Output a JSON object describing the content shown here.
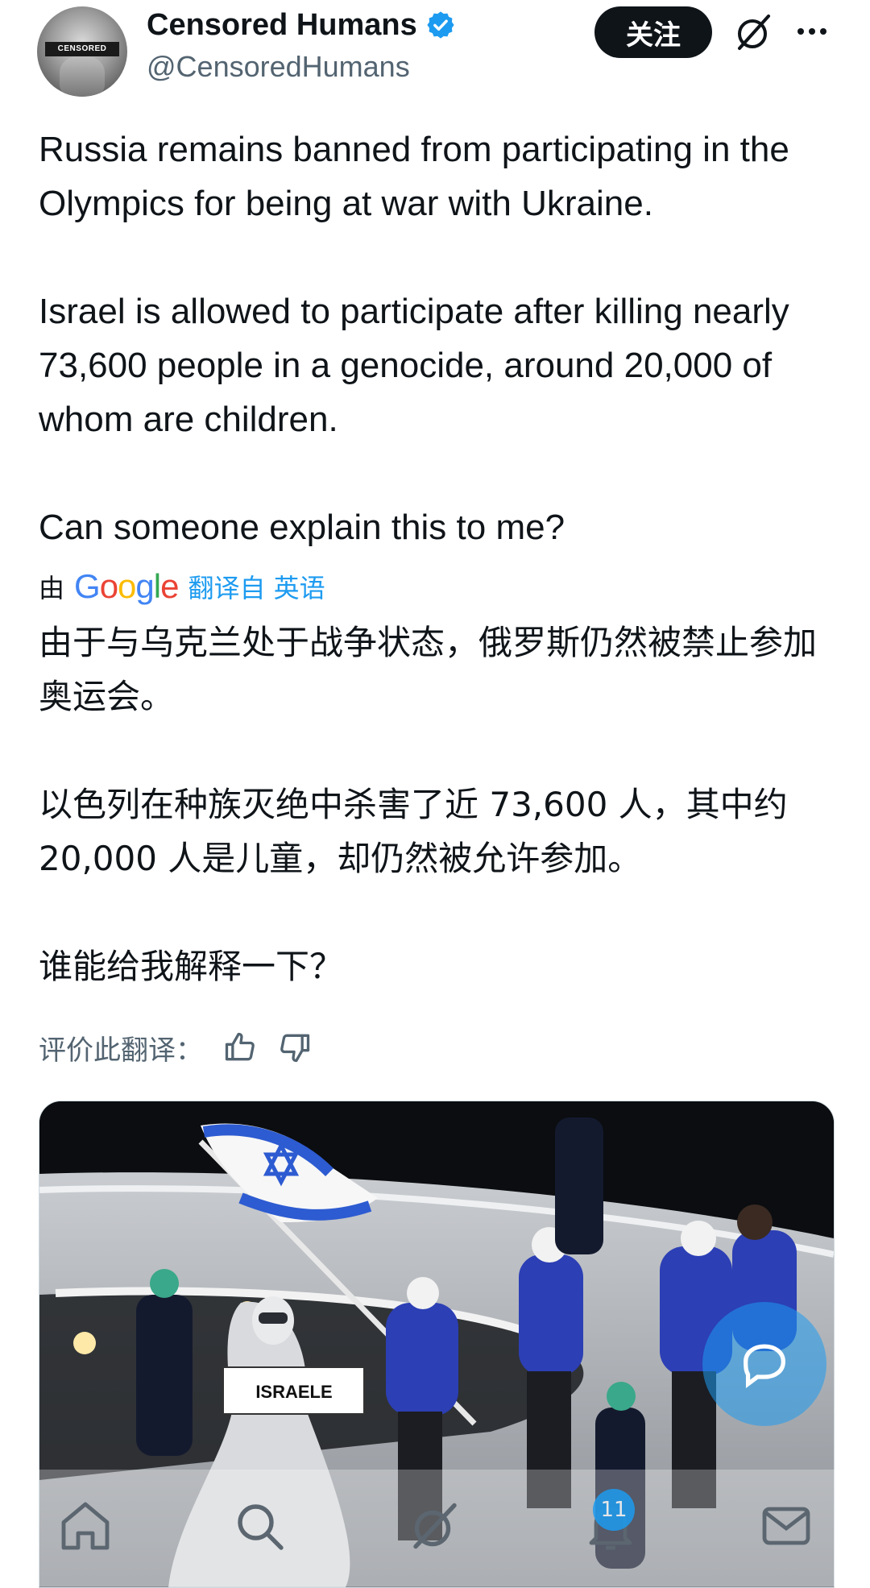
{
  "author": {
    "display_name": "Censored Humans",
    "handle": "@CensoredHumans",
    "avatar_band_text": "CENSORED",
    "verified": true
  },
  "header": {
    "follow_label": "关注",
    "grok_icon": "grok-icon",
    "more_icon": "more-icon"
  },
  "tweet": {
    "paragraphs": [
      "Russia remains banned from participating in the Olympics for being at war with Ukraine.",
      "Israel is allowed to participate after killing nearly 73,600 people in a genocide, around 20,000 of whom are children.",
      "Can someone explain this to me?"
    ]
  },
  "translation": {
    "by_label": "由",
    "google": "Google",
    "link_label": "翻译自 英语",
    "paragraphs": [
      "由于与乌克兰处于战争状态，俄罗斯仍然被禁止参加奥运会。",
      "以色列在种族灭绝中杀害了近 73,600 人，其中约 20,000 人是儿童，却仍然被允许参加。",
      "谁能给我解释一下？"
    ],
    "rate_label": "评价此翻译："
  },
  "media": {
    "sign_text": "ISRAELE"
  },
  "bottom_nav": {
    "items": [
      "home-icon",
      "search-icon",
      "grok-icon",
      "notifications-icon",
      "messages-icon"
    ],
    "notification_count": "11"
  },
  "colors": {
    "accent": "#1d9bf0",
    "text": "#0f1419",
    "secondary": "#536471"
  }
}
